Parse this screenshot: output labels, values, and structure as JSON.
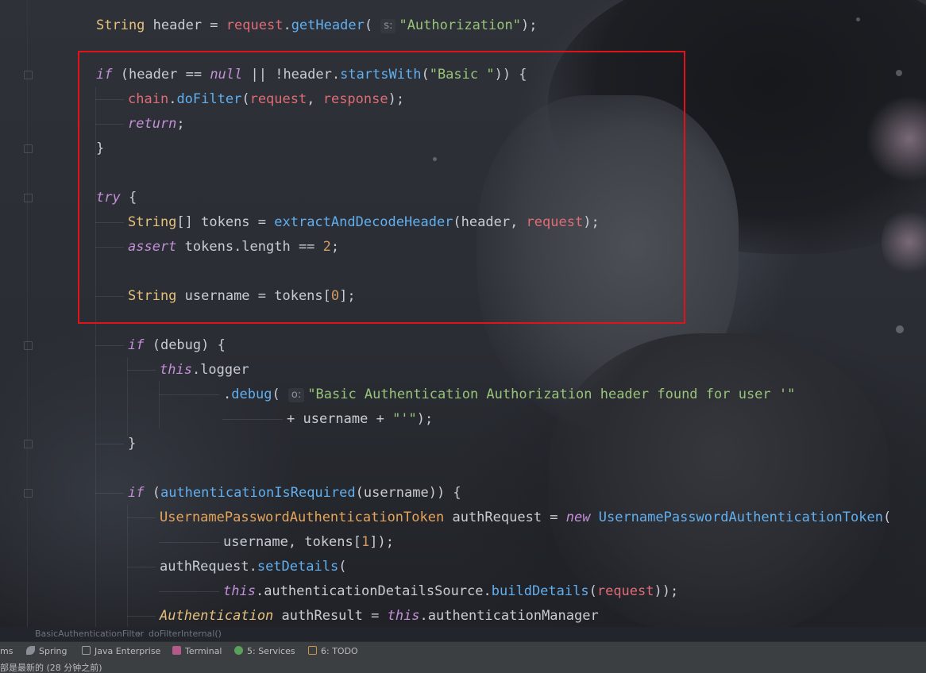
{
  "editor": {
    "lines": [
      {
        "id": "l1",
        "tokens": [
          [
            "type",
            "String"
          ],
          [
            "plain",
            " header = "
          ],
          [
            "var",
            "request"
          ],
          [
            "plain",
            "."
          ],
          [
            "fn",
            "getHeader"
          ],
          [
            "plain",
            "( "
          ],
          [
            "hint",
            "s:"
          ],
          [
            "str",
            "\"Authorization\""
          ],
          [
            "plain",
            ");"
          ]
        ]
      },
      {
        "id": "l2",
        "tokens": [
          [
            "kw",
            "if"
          ],
          [
            "plain",
            " (header == "
          ],
          [
            "kw",
            "null"
          ],
          [
            "plain",
            " || !header."
          ],
          [
            "fn",
            "startsWith"
          ],
          [
            "plain",
            "("
          ],
          [
            "str",
            "\"Basic \""
          ],
          [
            "plain",
            ")) {"
          ]
        ]
      },
      {
        "id": "l3",
        "tokens": [
          [
            "var",
            "chain"
          ],
          [
            "plain",
            "."
          ],
          [
            "fn",
            "doFilter"
          ],
          [
            "plain",
            "("
          ],
          [
            "var",
            "request"
          ],
          [
            "plain",
            ", "
          ],
          [
            "var",
            "response"
          ],
          [
            "plain",
            ");"
          ]
        ]
      },
      {
        "id": "l4",
        "tokens": [
          [
            "kw",
            "return"
          ],
          [
            "plain",
            ";"
          ]
        ]
      },
      {
        "id": "l5",
        "tokens": [
          [
            "plain",
            "}"
          ]
        ]
      },
      {
        "id": "l6",
        "tokens": [
          [
            "kw",
            "try"
          ],
          [
            "plain",
            " {"
          ]
        ]
      },
      {
        "id": "l7",
        "tokens": [
          [
            "type",
            "String"
          ],
          [
            "plain",
            "[] tokens = "
          ],
          [
            "fn",
            "extractAndDecodeHeader"
          ],
          [
            "plain",
            "(header, "
          ],
          [
            "var",
            "request"
          ],
          [
            "plain",
            ");"
          ]
        ]
      },
      {
        "id": "l8",
        "tokens": [
          [
            "kw",
            "assert"
          ],
          [
            "plain",
            " tokens.length == "
          ],
          [
            "num",
            "2"
          ],
          [
            "plain",
            ";"
          ]
        ]
      },
      {
        "id": "l9",
        "tokens": [
          [
            "type",
            "String"
          ],
          [
            "plain",
            " username = tokens["
          ],
          [
            "num",
            "0"
          ],
          [
            "plain",
            "];"
          ]
        ]
      },
      {
        "id": "l10",
        "tokens": [
          [
            "kw",
            "if"
          ],
          [
            "plain",
            " (debug) {"
          ]
        ]
      },
      {
        "id": "l11",
        "tokens": [
          [
            "kw",
            "this"
          ],
          [
            "plain",
            ".logger"
          ]
        ]
      },
      {
        "id": "l12",
        "tokens": [
          [
            "plain",
            "."
          ],
          [
            "fn",
            "debug"
          ],
          [
            "plain",
            "( "
          ],
          [
            "hint",
            "o:"
          ],
          [
            "str",
            "\"Basic Authentication Authorization header found for user '\""
          ]
        ]
      },
      {
        "id": "l13",
        "tokens": [
          [
            "plain",
            "+ username + "
          ],
          [
            "str",
            "\"'\""
          ],
          [
            "plain",
            ");"
          ]
        ]
      },
      {
        "id": "l14",
        "tokens": [
          [
            "plain",
            "}"
          ]
        ]
      },
      {
        "id": "l15",
        "tokens": [
          [
            "kw",
            "if"
          ],
          [
            "plain",
            " ("
          ],
          [
            "fn",
            "authenticationIsRequired"
          ],
          [
            "plain",
            "(username)) {"
          ]
        ]
      },
      {
        "id": "l16",
        "tokens": [
          [
            "cls",
            "UsernamePasswordAuthenticationToken"
          ],
          [
            "plain",
            " authRequest = "
          ],
          [
            "kw",
            "new"
          ],
          [
            "plain",
            " "
          ],
          [
            "fn",
            "UsernamePasswordAuthenticationToken"
          ],
          [
            "plain",
            "("
          ]
        ]
      },
      {
        "id": "l17",
        "tokens": [
          [
            "plain",
            "username, tokens["
          ],
          [
            "num",
            "1"
          ],
          [
            "plain",
            "]);"
          ]
        ]
      },
      {
        "id": "l18",
        "tokens": [
          [
            "plain",
            "authRequest."
          ],
          [
            "fn",
            "setDetails"
          ],
          [
            "plain",
            "("
          ]
        ]
      },
      {
        "id": "l19",
        "tokens": [
          [
            "kw",
            "this"
          ],
          [
            "plain",
            ".authenticationDetailsSource."
          ],
          [
            "fn",
            "buildDetails"
          ],
          [
            "plain",
            "("
          ],
          [
            "var",
            "request"
          ],
          [
            "plain",
            "));"
          ]
        ]
      },
      {
        "id": "l20",
        "tokens": [
          [
            "ital-type",
            "Authentication"
          ],
          [
            "plain",
            " authResult = "
          ],
          [
            "kw",
            "this"
          ],
          [
            "plain",
            ".authenticationManager"
          ]
        ]
      }
    ]
  },
  "breadcrumb": {
    "class_name": "BasicAuthenticationFilter",
    "separator": "›",
    "method_name": "doFilterInternal()"
  },
  "toolbar": {
    "items": [
      {
        "label": "ms",
        "icon": "none"
      },
      {
        "label": "Spring",
        "icon": "spring-leaf-icon"
      },
      {
        "label": "Java Enterprise",
        "icon": "java-enterprise-icon"
      },
      {
        "label": "Terminal",
        "icon": "terminal-icon"
      },
      {
        "label": "5: Services",
        "icon": "services-gear-icon"
      },
      {
        "label": "6: TODO",
        "icon": "todo-list-icon"
      }
    ]
  },
  "status": {
    "message": "部是最新的 (28 分钟之前)"
  },
  "colors": {
    "highlight_border": "#e2121b",
    "keyword": "#c38fd6",
    "type": "#e5c07b",
    "function": "#61afef",
    "string": "#98c379",
    "number": "#d19a66"
  }
}
